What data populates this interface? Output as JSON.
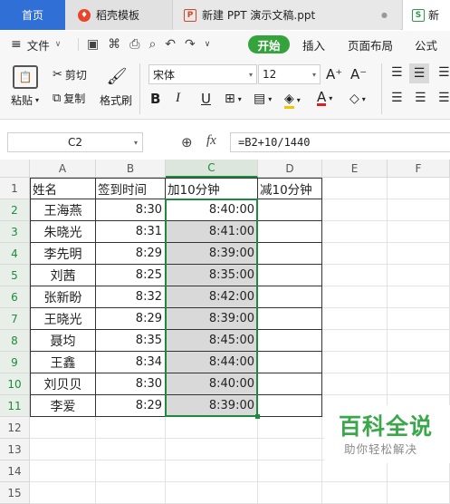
{
  "tabs": {
    "home": "首页",
    "shell": "稻壳模板",
    "ppt": "新建 PPT 演示文稿.ppt",
    "xls": "新",
    "ppt_dot": "●"
  },
  "menu": {
    "file": "文件",
    "start": "开始",
    "insert": "插入",
    "page_layout": "页面布局",
    "formula": "公式"
  },
  "ribbon": {
    "paste": "粘贴",
    "cut": "剪切",
    "copy": "复制",
    "format_painter": "格式刷",
    "font_name": "宋体",
    "font_size": "12",
    "grow_font": "A⁺",
    "shrink_font": "A⁻",
    "bold": "B",
    "italic": "I",
    "underline": "U",
    "font_color_glyph": "A"
  },
  "formula_bar": {
    "name_box": "C2",
    "fx": "fx",
    "formula": "=B2+10/1440"
  },
  "columns": [
    "A",
    "B",
    "C",
    "D",
    "E",
    "F"
  ],
  "rows": [
    "1",
    "2",
    "3",
    "4",
    "5",
    "6",
    "7",
    "8",
    "9",
    "10",
    "11",
    "12",
    "13",
    "14",
    "15"
  ],
  "header_row": [
    "姓名",
    "签到时间",
    "加10分钟",
    "减10分钟"
  ],
  "data_rows": [
    [
      "王海燕",
      "8:30",
      "8:40:00"
    ],
    [
      "朱晓光",
      "8:31",
      "8:41:00"
    ],
    [
      "李先明",
      "8:29",
      "8:39:00"
    ],
    [
      "刘茜",
      "8:25",
      "8:35:00"
    ],
    [
      "张新盼",
      "8:32",
      "8:42:00"
    ],
    [
      "王晓光",
      "8:29",
      "8:39:00"
    ],
    [
      "聂均",
      "8:35",
      "8:45:00"
    ],
    [
      "王鑫",
      "8:34",
      "8:44:00"
    ],
    [
      "刘贝贝",
      "8:30",
      "8:40:00"
    ],
    [
      "李爱",
      "8:29",
      "8:39:00"
    ]
  ],
  "watermark": {
    "title": "百科全说",
    "subtitle": "助你轻松解决"
  },
  "colors": {
    "accent_green": "#35a33c",
    "tab_blue": "#2f6fd6",
    "selection_green": "#1e8a3e",
    "selection_fill": "#d9d9d9",
    "watermark_green": "#3aa84a"
  }
}
